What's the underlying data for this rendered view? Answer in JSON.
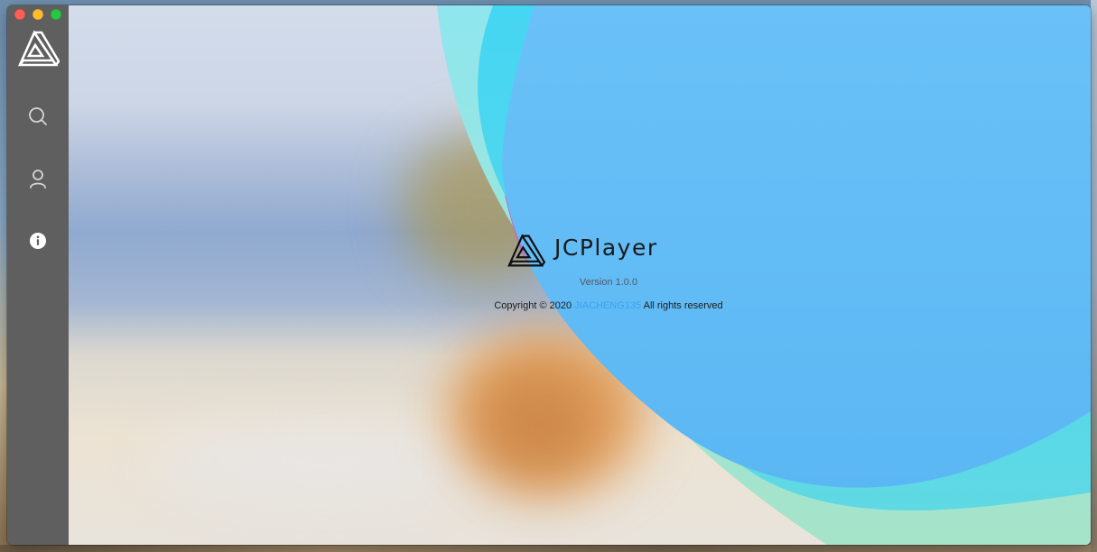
{
  "window": {
    "controls": {
      "close_color": "#fd5f57",
      "minimize_color": "#febc2e",
      "maximize_color": "#28c840"
    }
  },
  "sidebar": {
    "logo_icon": "triangle-logo-icon",
    "items": [
      {
        "id": "search",
        "icon": "search-icon"
      },
      {
        "id": "user",
        "icon": "user-icon"
      },
      {
        "id": "about",
        "icon": "info-icon",
        "active": true
      }
    ],
    "background": "#5f5f5f"
  },
  "about": {
    "app_name": "JCPlayer",
    "version": "Version 1.0.0",
    "copyright_prefix": "Copyright © 2020 ",
    "author": "JIACHENG135",
    "copyright_suffix": " All rights reserved",
    "author_link_color": "#3aa3f0"
  },
  "colors": {
    "wave_blue": "#5ab8f5",
    "wave_cyan": "#4fd8ef",
    "wave_mint": "#9be5d8",
    "wave_magenta": "#d957b8"
  }
}
